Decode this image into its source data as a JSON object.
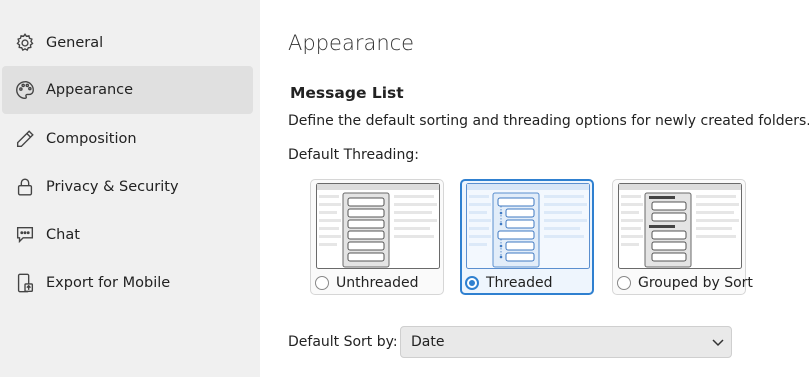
{
  "sidebar": {
    "items": [
      {
        "label": "General",
        "icon": "gear-icon"
      },
      {
        "label": "Appearance",
        "icon": "palette-icon",
        "selected": true
      },
      {
        "label": "Composition",
        "icon": "pencil-icon"
      },
      {
        "label": "Privacy & Security",
        "icon": "lock-icon"
      },
      {
        "label": "Chat",
        "icon": "chat-icon"
      },
      {
        "label": "Export for Mobile",
        "icon": "mobile-export-icon"
      }
    ]
  },
  "main": {
    "title": "Appearance",
    "section_title": "Message List",
    "description": "Define the default sorting and threading options for newly created folders.",
    "threading_label": "Default Threading:",
    "threading_options": [
      {
        "label": "Unthreaded",
        "selected": false
      },
      {
        "label": "Threaded",
        "selected": true
      },
      {
        "label": "Grouped by Sort",
        "selected": false
      }
    ],
    "sort_label": "Default Sort by:",
    "sort_value": "Date"
  },
  "colors": {
    "accent": "#2f80d0",
    "sidebar_bg": "#f0f0f0",
    "selected_item_bg": "#e0e0e0"
  }
}
